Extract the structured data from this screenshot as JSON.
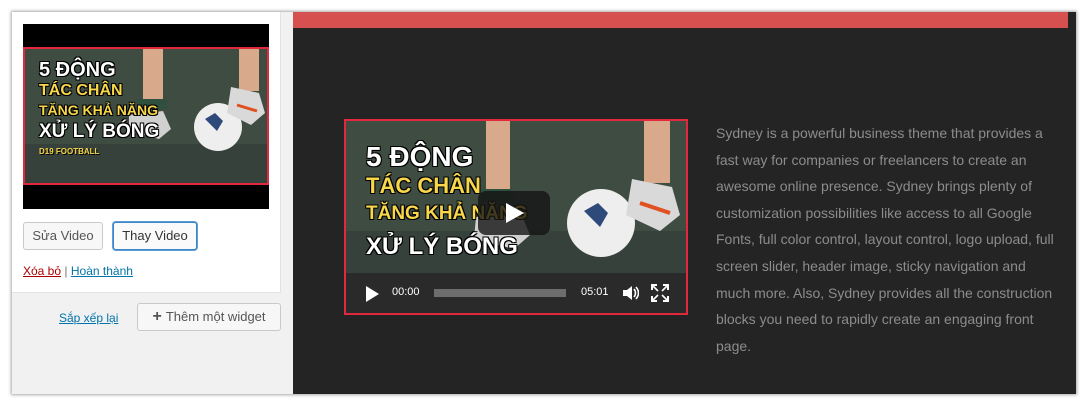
{
  "thumbnail": {
    "lines": [
      "5 ĐỘNG",
      "TÁC CHÂN",
      "TĂNG KHẢ NĂNG",
      "XỬ LÝ BÓNG"
    ],
    "channel": "D19 FOOTBALL"
  },
  "widget": {
    "edit_label": "Sửa Video",
    "replace_label": "Thay Video",
    "delete_label": "Xóa bỏ",
    "separator": "|",
    "done_label": "Hoàn thành"
  },
  "footer": {
    "reorder_label": "Sắp xếp lại",
    "add_widget_label": "Thêm một widget"
  },
  "player": {
    "lines": [
      "5 ĐỘNG",
      "TÁC CHÂN",
      "TĂNG KHẢ NĂNG",
      "XỬ LÝ BÓNG"
    ],
    "current_time": "00:00",
    "duration": "05:01",
    "progress": 0
  },
  "preview": {
    "accent_color": "#d65050",
    "description": "Sydney is a powerful business theme that provides a fast way for companies or freelancers to create an awesome online presence. Sydney brings plenty of customization possibilities like access to all Google Fonts, full color control, layout control, logo upload, full screen slider, header image, sticky navigation and much more. Also, Sydney provides all the construction blocks you need to rapidly create an engaging front page."
  }
}
